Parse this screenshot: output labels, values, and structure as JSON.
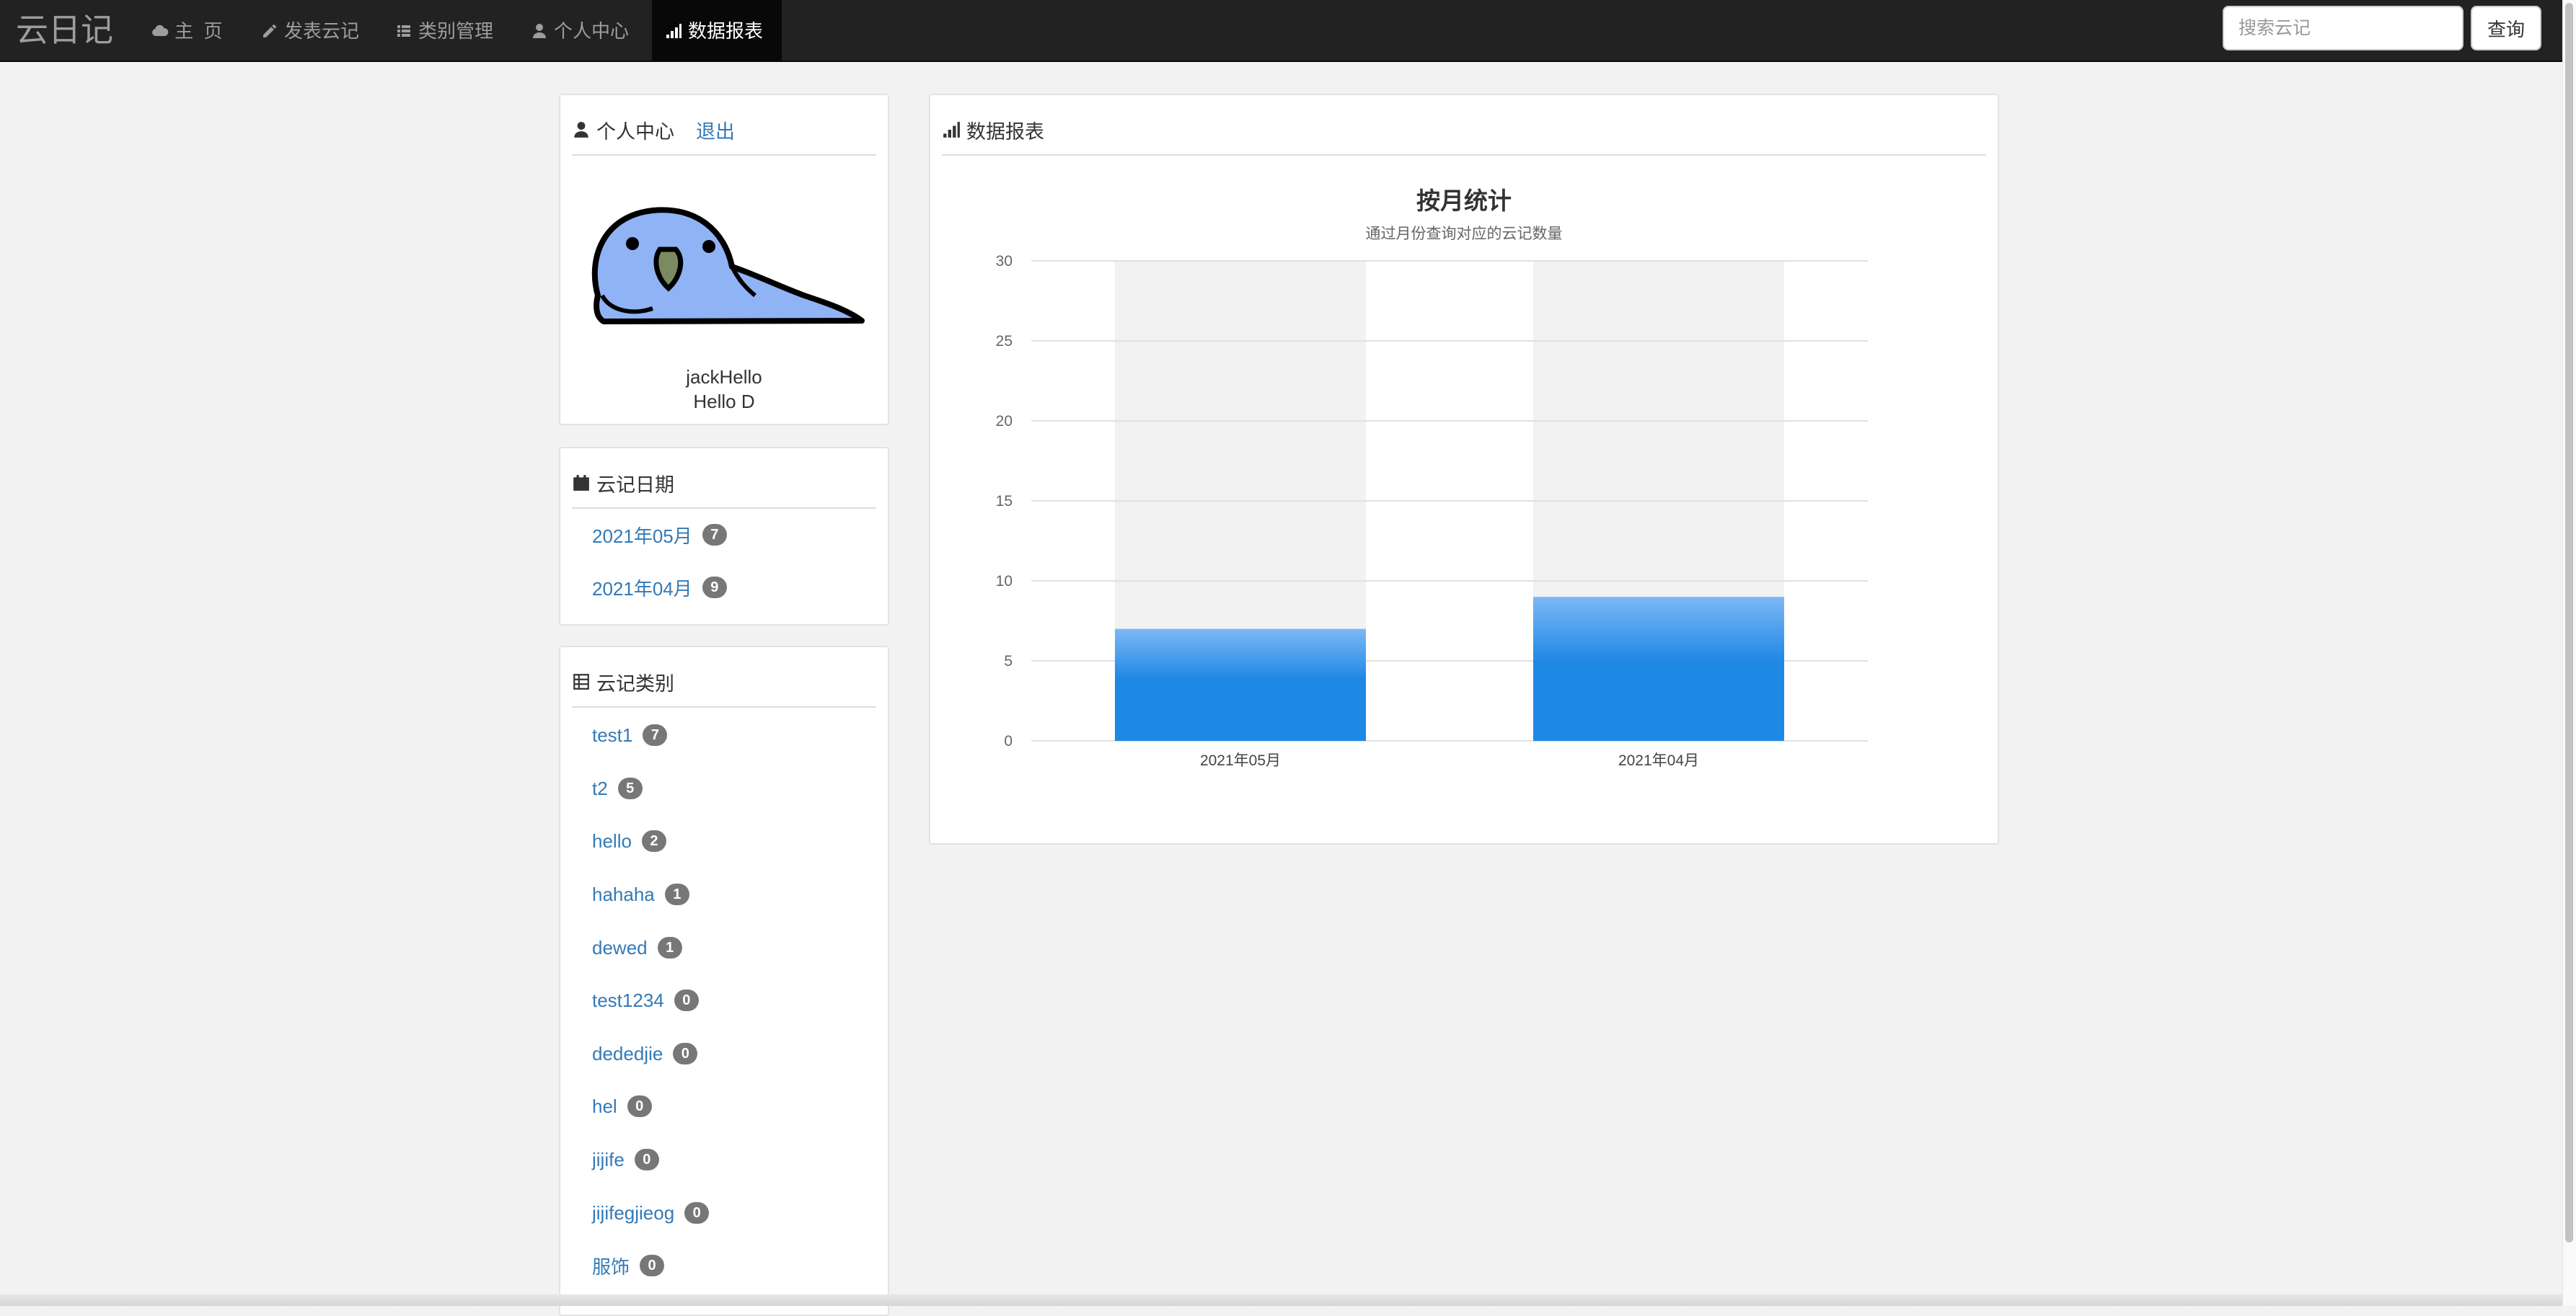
{
  "navbar": {
    "brand": "云日记",
    "items": [
      {
        "label": "主  页",
        "icon": "cloud-icon"
      },
      {
        "label": "发表云记",
        "icon": "pencil-icon"
      },
      {
        "label": "类别管理",
        "icon": "list-icon"
      },
      {
        "label": "个人中心",
        "icon": "user-icon"
      },
      {
        "label": "数据报表",
        "icon": "signal-icon",
        "active": true
      }
    ],
    "search_placeholder": "搜索云记",
    "search_button": "查询"
  },
  "profile": {
    "title": "个人中心",
    "logout": "退出",
    "username": "jackHello",
    "signature": "Hello D"
  },
  "dates": {
    "title": "云记日期",
    "items": [
      {
        "label": "2021年05月",
        "count": "7"
      },
      {
        "label": "2021年04月",
        "count": "9"
      }
    ]
  },
  "categories": {
    "title": "云记类别",
    "items": [
      {
        "label": "test1",
        "count": "7"
      },
      {
        "label": "t2",
        "count": "5"
      },
      {
        "label": "hello",
        "count": "2"
      },
      {
        "label": "hahaha",
        "count": "1"
      },
      {
        "label": "dewed",
        "count": "1"
      },
      {
        "label": "test1234",
        "count": "0"
      },
      {
        "label": "dededjie",
        "count": "0"
      },
      {
        "label": "hel",
        "count": "0"
      },
      {
        "label": "jijife",
        "count": "0"
      },
      {
        "label": "jijifegjieog",
        "count": "0"
      },
      {
        "label": "服饰",
        "count": "0"
      }
    ]
  },
  "report": {
    "title": "数据报表"
  },
  "colors": {
    "accent": "#1e88e5",
    "link": "#337ab7",
    "badge": "#777777",
    "navbar": "#222222"
  },
  "chart_data": {
    "type": "bar",
    "title": "按月统计",
    "subtitle": "通过月份查询对应的云记数量",
    "categories": [
      "2021年05月",
      "2021年04月"
    ],
    "values": [
      7,
      9
    ],
    "ylim": [
      0,
      30
    ],
    "yticks": [
      "0",
      "5",
      "10",
      "15",
      "20",
      "25",
      "30"
    ],
    "xlabel": "",
    "ylabel": "",
    "grid": true,
    "legend": "none"
  }
}
